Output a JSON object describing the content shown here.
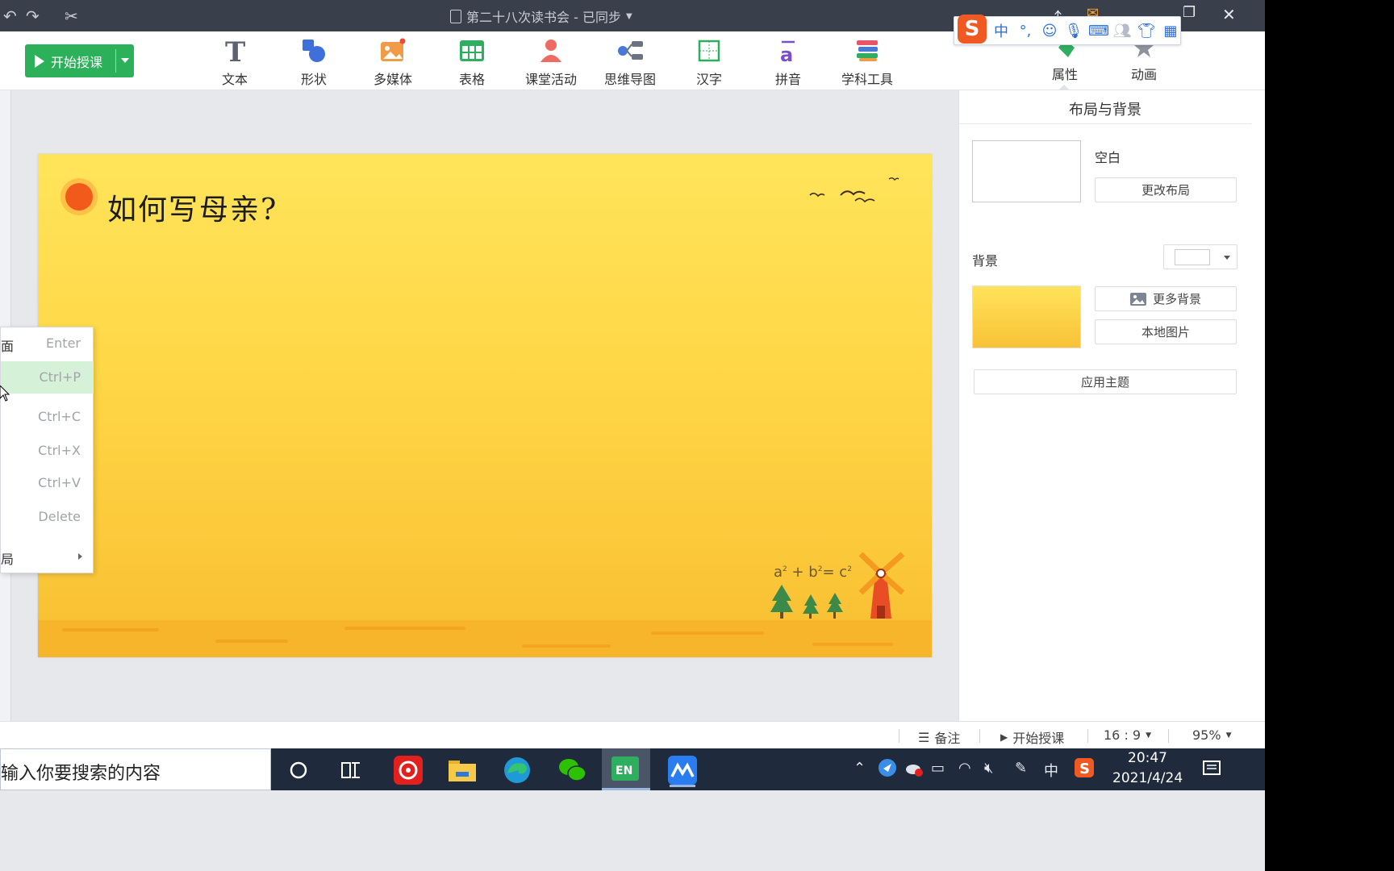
{
  "titlebar": {
    "doc_title": "第二十八次读书会 - 已同步",
    "close": "✕"
  },
  "ime": {
    "logo": "S",
    "mode": "中",
    "punct": "°,"
  },
  "toolbar": {
    "start_class": "开始授课",
    "tools": [
      {
        "label": "文本",
        "icon": "text-icon"
      },
      {
        "label": "形状",
        "icon": "shape-icon"
      },
      {
        "label": "多媒体",
        "icon": "media-icon"
      },
      {
        "label": "表格",
        "icon": "table-icon"
      },
      {
        "label": "课堂活动",
        "icon": "class-activity-icon"
      },
      {
        "label": "思维导图",
        "icon": "mindmap-icon"
      },
      {
        "label": "汉字",
        "icon": "hanzi-icon"
      },
      {
        "label": "拼音",
        "icon": "pinyin-icon"
      },
      {
        "label": "学科工具",
        "icon": "subject-tools-icon"
      }
    ],
    "tabs": [
      {
        "label": "属性"
      },
      {
        "label": "动画"
      }
    ]
  },
  "slide": {
    "title": "如何写母亲?",
    "formula": {
      "a": "a",
      "b": "b",
      "c": "c",
      "exp": "2",
      "plus": " + ",
      "eq": "= "
    }
  },
  "panel": {
    "title": "布局与背景",
    "layout_name": "空白",
    "change_layout": "更改布局",
    "background_label": "背景",
    "more_backgrounds": "更多背景",
    "local_image": "本地图片",
    "apply_theme": "应用主题"
  },
  "statusbar": {
    "notes": "备注",
    "start_class": "开始授课",
    "ratio": "16 : 9",
    "zoom": "95%"
  },
  "context_menu": {
    "items": [
      {
        "label": "面",
        "shortcut": "Enter"
      },
      {
        "label": "",
        "shortcut": "Ctrl+P"
      },
      {
        "label": "",
        "shortcut": "Ctrl+C"
      },
      {
        "label": "",
        "shortcut": "Ctrl+X"
      },
      {
        "label": "",
        "shortcut": "Ctrl+V"
      },
      {
        "label": "",
        "shortcut": "Delete"
      },
      {
        "label": "局",
        "shortcut": ""
      }
    ]
  },
  "taskbar": {
    "search_placeholder": "输入你要搜索的内容",
    "tray_lang": "中",
    "time": "20:47",
    "date": "2021/4/24"
  },
  "colors": {
    "accent_green": "#2db05a",
    "titlebar": "#3a3f4c",
    "slide_yellow": "#ffd848",
    "menu_highlight": "#d5f2d9"
  }
}
